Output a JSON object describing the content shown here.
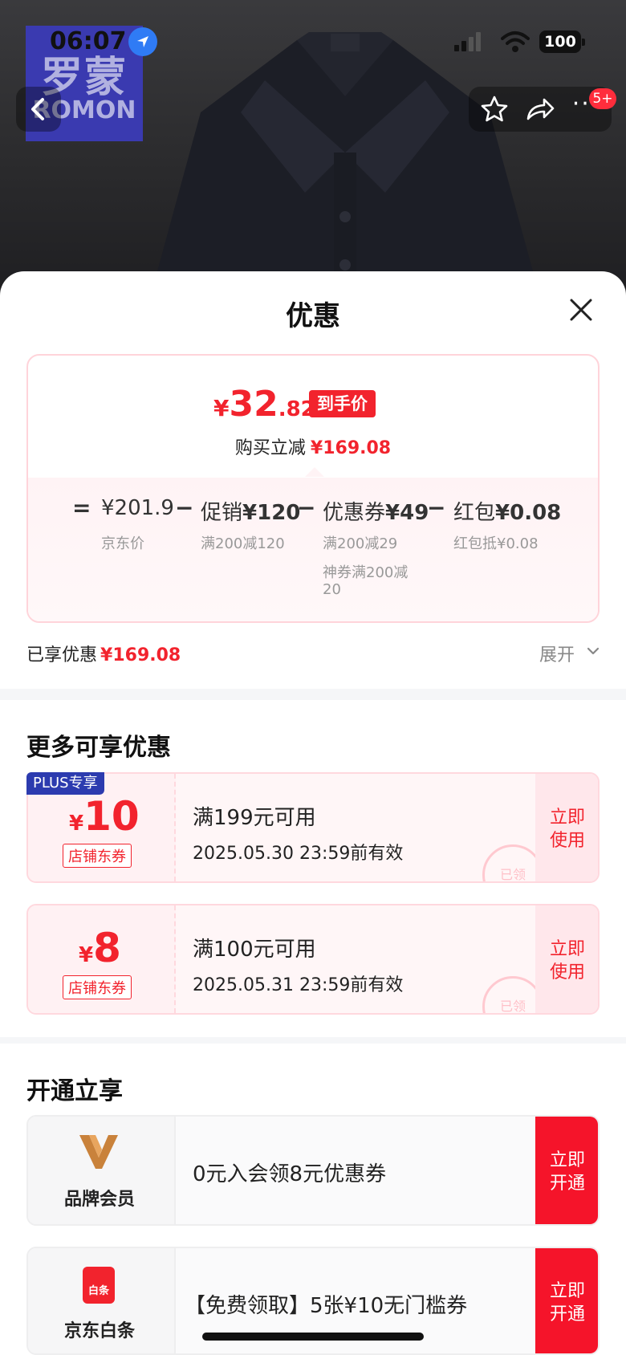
{
  "status_bar": {
    "time": "06:07",
    "battery": "100"
  },
  "product_bg": {
    "logo_cn": "罗蒙",
    "logo_en": "ROMON",
    "cart_badge": "5+"
  },
  "sheet": {
    "title": "优惠"
  },
  "price_summary": {
    "currency": "¥",
    "final_int": "32",
    "final_dec": ".82",
    "final_tag": "到手价",
    "instant_discount_label": "购买立减",
    "instant_discount_value": "¥169.08",
    "breakdown": [
      {
        "op": "=",
        "main_label": "",
        "main_value": "¥201.9",
        "sub": [
          "京东价"
        ]
      },
      {
        "op": "−",
        "main_label": "促销",
        "main_value": "¥120",
        "sub": [
          "满200减120"
        ]
      },
      {
        "op": "−",
        "main_label": "优惠券",
        "main_value": "¥49",
        "sub": [
          "满200减29",
          "神券满200减",
          "20"
        ]
      },
      {
        "op": "−",
        "main_label": "红包",
        "main_value": "¥0.08",
        "sub": [
          "红包抵¥0.08"
        ]
      }
    ]
  },
  "enjoyed": {
    "label": "已享优惠",
    "value": "¥169.08",
    "expand_label": "展开"
  },
  "more_offers": {
    "title": "更多可享优惠",
    "coupons": [
      {
        "plus_tag": "PLUS专享",
        "symbol": "¥",
        "amount": "10",
        "type": "店铺东券",
        "condition": "满199元可用",
        "valid": "2025.05.30 23:59前有效",
        "stamp": "已领",
        "button": [
          "立即",
          "使用"
        ]
      },
      {
        "plus_tag": "",
        "symbol": "¥",
        "amount": "8",
        "type": "店铺东券",
        "condition": "满100元可用",
        "valid": "2025.05.31 23:59前有效",
        "stamp": "已领",
        "button": [
          "立即",
          "使用"
        ]
      }
    ]
  },
  "membership": {
    "title": "开通立享",
    "items": [
      {
        "name": "品牌会员",
        "text": "0元入会领8元优惠券",
        "button": [
          "立即",
          "开通"
        ]
      },
      {
        "name": "京东白条",
        "icon_text": "白条",
        "text": "【免费领取】5张¥10无门槛券",
        "button": [
          "立即",
          "开通"
        ]
      }
    ]
  },
  "colors": {
    "accent_red": "#F2232D",
    "plus_blue": "#2C3BAF",
    "open_red": "#F5142A"
  }
}
